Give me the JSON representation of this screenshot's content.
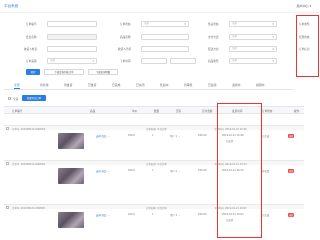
{
  "header": {
    "title": "平台系统",
    "right": "用户中心 ▾"
  },
  "filters": [
    {
      "label": "订单编号:",
      "value": ""
    },
    {
      "label": "订单状态:",
      "value": "全部"
    },
    {
      "label": "售后状态:",
      "value": "全部"
    },
    {
      "label": "会员名称:",
      "value": ""
    },
    {
      "label": "商品名称:",
      "value": ""
    },
    {
      "label": "支付方式:",
      "value": "全部"
    },
    {
      "label": "收货人姓名:",
      "value": ""
    },
    {
      "label": "收货人手机:",
      "value": ""
    },
    {
      "label": "配送方式:",
      "value": "全部"
    },
    {
      "label": "订单来源:",
      "value": "全部"
    },
    {
      "label": "下单时间:",
      "value": ""
    },
    {
      "label": "商品类型:",
      "value": "全部"
    }
  ],
  "right_filters": [
    "订单类型:",
    "结算状态:",
    "订单标记:"
  ],
  "buttons": {
    "search": "搜索",
    "export_list": "下载查询列表订单",
    "export_detail": "下载查询明细"
  },
  "tabs": [
    "全部",
    "待付款",
    "待发货",
    "已发货",
    "已完成",
    "已关闭",
    "售后中",
    "待审核",
    "已退款",
    "退款中",
    "拼团中"
  ],
  "batch_button": "批量导出订单",
  "columns": [
    "订单编号",
    "商品",
    "单价",
    "数量",
    "买家",
    "实付金额",
    "发货时间",
    "订单状态",
    "操作"
  ],
  "orders": [
    {
      "order_no": "订单号: 2019081211490563",
      "meta": "订单来源: 平台订单",
      "time": "下单时间: 2019-10-21 16:46",
      "title": "云网 商品 ...",
      "price": "¥49.0",
      "qty": "1",
      "buyer": "用户 1 ...",
      "paid": "¥49.00",
      "ship_time": "2019-10-21 16:46",
      "ship_status": "已发货",
      "status": "已完成",
      "tag": "退款"
    },
    {
      "order_no": "订单号: 2019081211490564",
      "meta": "订单来源: 平台订单",
      "time": "下单时间: 2019-10-21 16:23",
      "title": "云网 商品 ...",
      "price": "¥49.0",
      "qty": "1",
      "buyer": "用户 2 ...",
      "paid": "¥49.00",
      "ship_time": "2019-10-21 16:23",
      "ship_status": "",
      "status": "待发货",
      "tag": "退款"
    },
    {
      "order_no": "订单号: 2019081211490565",
      "meta": "订单来源: 平台订单",
      "time": "下单时间: 2019-10-21 16:03",
      "title": "云网 商品 ...",
      "price": "¥49.0",
      "qty": "1",
      "buyer": "用户 3 ...",
      "paid": "¥49.00",
      "ship_time": "2019-10-21 16:03",
      "ship_status": "已发货",
      "status": "已完成",
      "tag": "退款"
    }
  ],
  "colors": {
    "accent": "#2a7de1",
    "highlight": "#e33333"
  }
}
